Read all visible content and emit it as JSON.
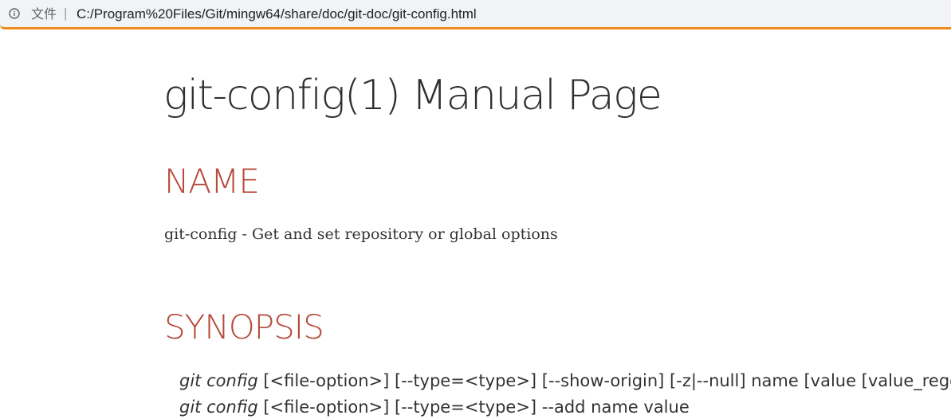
{
  "browser": {
    "address_label": "文件",
    "separator": "|",
    "url": "C:/Program%20Files/Git/mingw64/share/doc/git-doc/git-config.html",
    "accent_color": "#ef8a1c"
  },
  "page": {
    "title": "git-config(1) Manual Page",
    "sections": {
      "name": {
        "heading": "NAME",
        "description": "git-config - Get and set repository or global options"
      },
      "synopsis": {
        "heading": "SYNOPSIS",
        "lines": [
          {
            "command": "git config",
            "args": " [<file-option>] [--type=<type>] [--show-origin] [-z|--null] name [value [value_regex]]"
          },
          {
            "command": "git config",
            "args": " [<file-option>] [--type=<type>] --add name value"
          }
        ]
      }
    },
    "heading_color": "#b74a3a"
  }
}
